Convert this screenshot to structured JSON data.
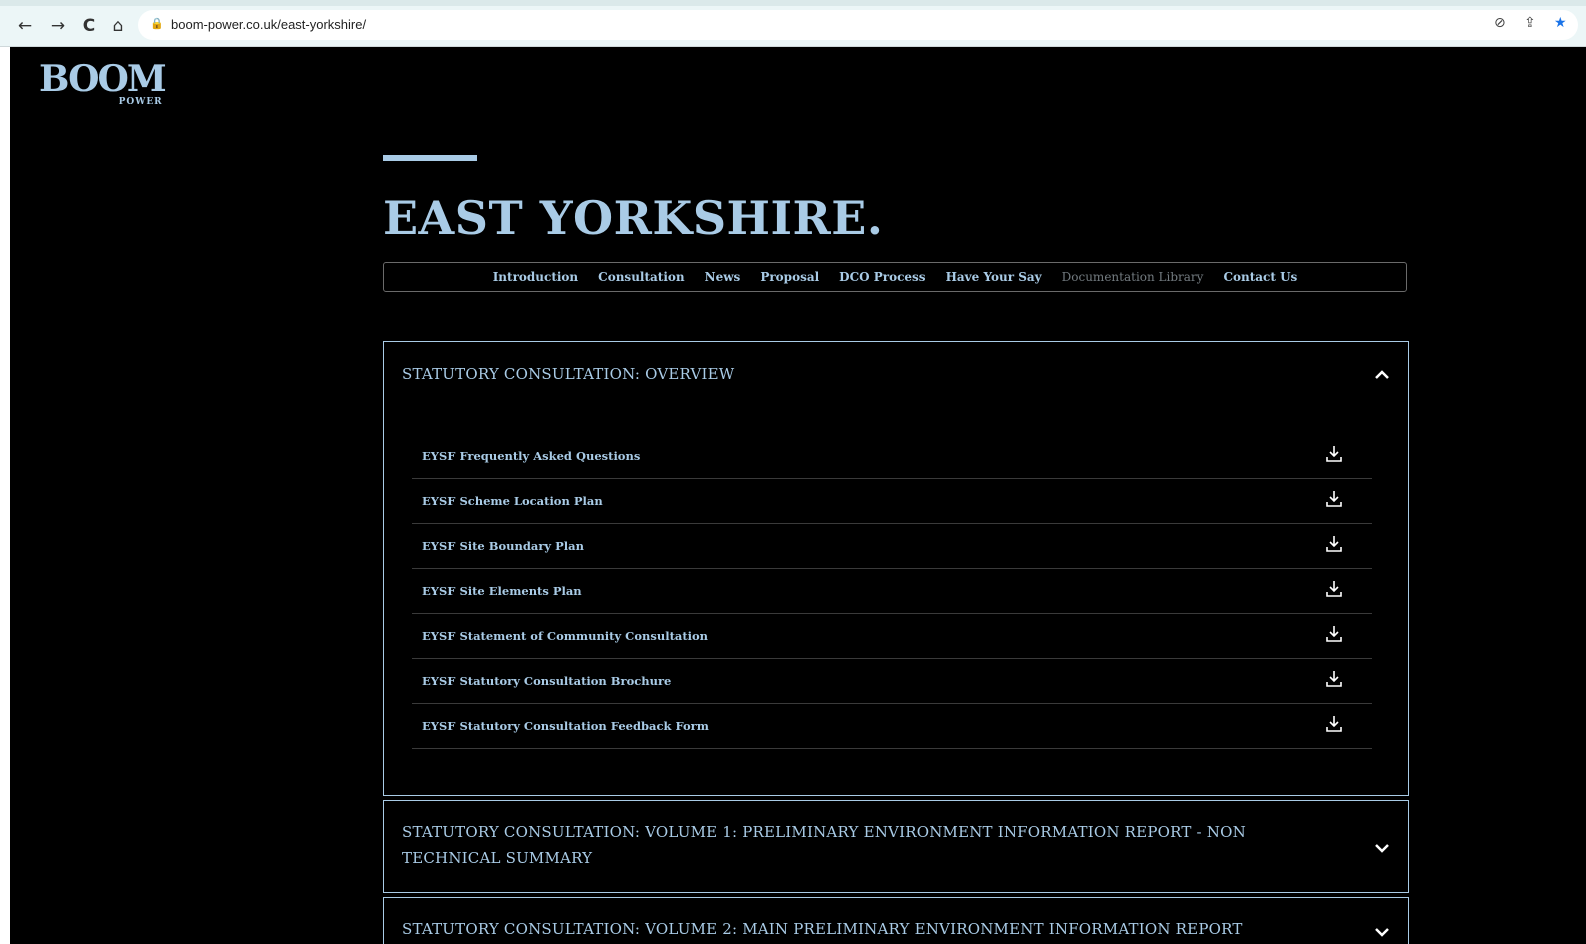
{
  "browser": {
    "url": "boom-power.co.uk/east-yorkshire/",
    "back_icon": "←",
    "forward_icon": "→",
    "reload_icon": "C",
    "home_icon": "⌂",
    "lock_icon": "🔒",
    "eye_icon": "⊘",
    "share_icon": "⇪",
    "star_icon": "★"
  },
  "logo": {
    "main": "BOOM",
    "sub": "POWER"
  },
  "page": {
    "title": "EAST YORKSHIRE."
  },
  "subnav": {
    "items": [
      {
        "label": "Introduction"
      },
      {
        "label": "Consultation"
      },
      {
        "label": "News"
      },
      {
        "label": "Proposal"
      },
      {
        "label": "DCO Process"
      },
      {
        "label": "Have Your Say"
      },
      {
        "label": "Documentation Library",
        "active": true
      },
      {
        "label": "Contact Us"
      }
    ]
  },
  "accordions": [
    {
      "title": "STATUTORY CONSULTATION: OVERVIEW",
      "expanded": true,
      "docs": [
        "EYSF Frequently Asked Questions",
        "EYSF Scheme Location Plan",
        "EYSF Site Boundary Plan",
        "EYSF Site Elements Plan",
        "EYSF Statement of Community Consultation",
        "EYSF Statutory Consultation Brochure",
        "EYSF Statutory Consultation Feedback Form"
      ]
    },
    {
      "title": "STATUTORY CONSULTATION: VOLUME 1: PRELIMINARY ENVIRONMENT INFORMATION REPORT - NON TECHNICAL SUMMARY",
      "expanded": false
    },
    {
      "title": "STATUTORY CONSULTATION: VOLUME 2: MAIN PRELIMINARY ENVIRONMENT INFORMATION REPORT",
      "expanded": false
    }
  ],
  "icons": {
    "collapse": "chevron-up-icon",
    "expand": "chevron-down-icon",
    "download": "download-icon"
  },
  "colors": {
    "accent": "#a9cbe6",
    "background": "#000000",
    "muted": "#737b80"
  }
}
